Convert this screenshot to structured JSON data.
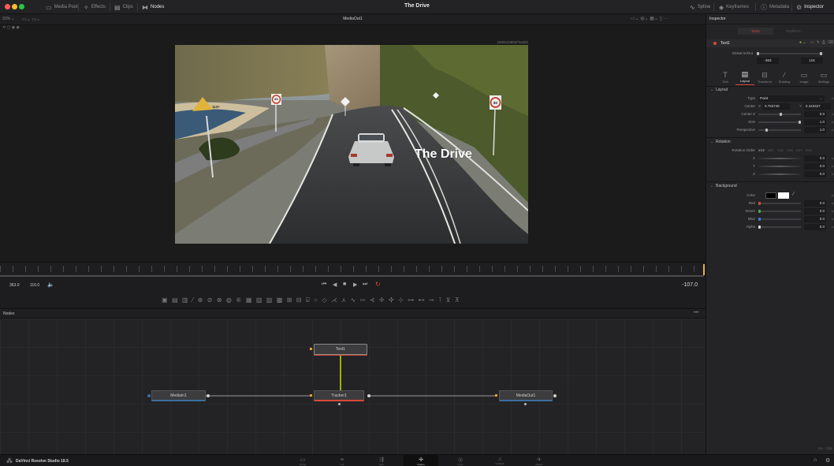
{
  "window": {
    "title": "The Drive"
  },
  "toolbar": {
    "media_pool": "Media Pool",
    "effects": "Effects",
    "clips": "Clips",
    "nodes": "Nodes",
    "spline": "Spline",
    "keyframes": "Keyframes",
    "metadata": "Metadata",
    "inspector": "Inspector"
  },
  "viewer": {
    "zoom": "31% ⌄",
    "title": "MediaOut1",
    "resolution": "1920x1080xFloat32",
    "overlay_text": "The Drive",
    "sign_speed": "80",
    "sign_yellow": "113+"
  },
  "transport": {
    "start_time": "363.0",
    "end_frame": "116.0",
    "current_time": "-107.0"
  },
  "nodes_panel": {
    "label": "Nodes",
    "more": "•••",
    "nodes": {
      "text": "Text1",
      "media_in": "MediaIn1",
      "tracker": "Tracker1",
      "media_out": "MediaOut1"
    }
  },
  "inspector": {
    "header": "Inspector",
    "tab_tools": "Tools",
    "tab_modifiers": "Modifiers",
    "node_name": "Text1",
    "global_inout_label": "Global In/Out",
    "global_in": "-363",
    "global_out": "116",
    "tabs": [
      "Text",
      "Layout",
      "Transform",
      "Shading",
      "Image",
      "Settings"
    ],
    "layout_section": "Layout",
    "type_label": "Type",
    "type_value": "Point",
    "center_label": "Center",
    "center_x_label": "X",
    "center_x": "0.753745",
    "center_y_label": "Y",
    "center_y": "0.443427",
    "center_z_label": "Center Z",
    "center_z": "0.0",
    "size_label": "Size",
    "size": "1.0",
    "perspective_label": "Perspective",
    "perspective": "1.0",
    "rotation_section": "Rotation",
    "rotation_order_label": "Rotation Order",
    "rotation_orders": [
      "XYZ",
      "XZY",
      "YXZ",
      "YZX",
      "ZXY",
      "ZYX"
    ],
    "rot_x_label": "X",
    "rot_x": "0.0",
    "rot_y_label": "Y",
    "rot_y": "0.0",
    "rot_z_label": "Z",
    "rot_z": "0.0",
    "background_section": "Background",
    "color_label": "Color",
    "red_label": "Red",
    "red": "0.0",
    "green_label": "Green",
    "green": "0.0",
    "blue_label": "Blue",
    "blue": "0.0",
    "alpha_label": "Alpha",
    "alpha": "0.0",
    "status": "5% · 7330"
  },
  "bottombar": {
    "app_name": "DaVinci Resolve Studio 18.5",
    "pages": [
      "Media",
      "Cut",
      "Edit",
      "Fusion",
      "Color",
      "Fairlight",
      "Deliver"
    ]
  },
  "colors": {
    "accent": "#d84a3a",
    "tracker_line": "#c8e000",
    "node_selected": "#e0a030"
  }
}
